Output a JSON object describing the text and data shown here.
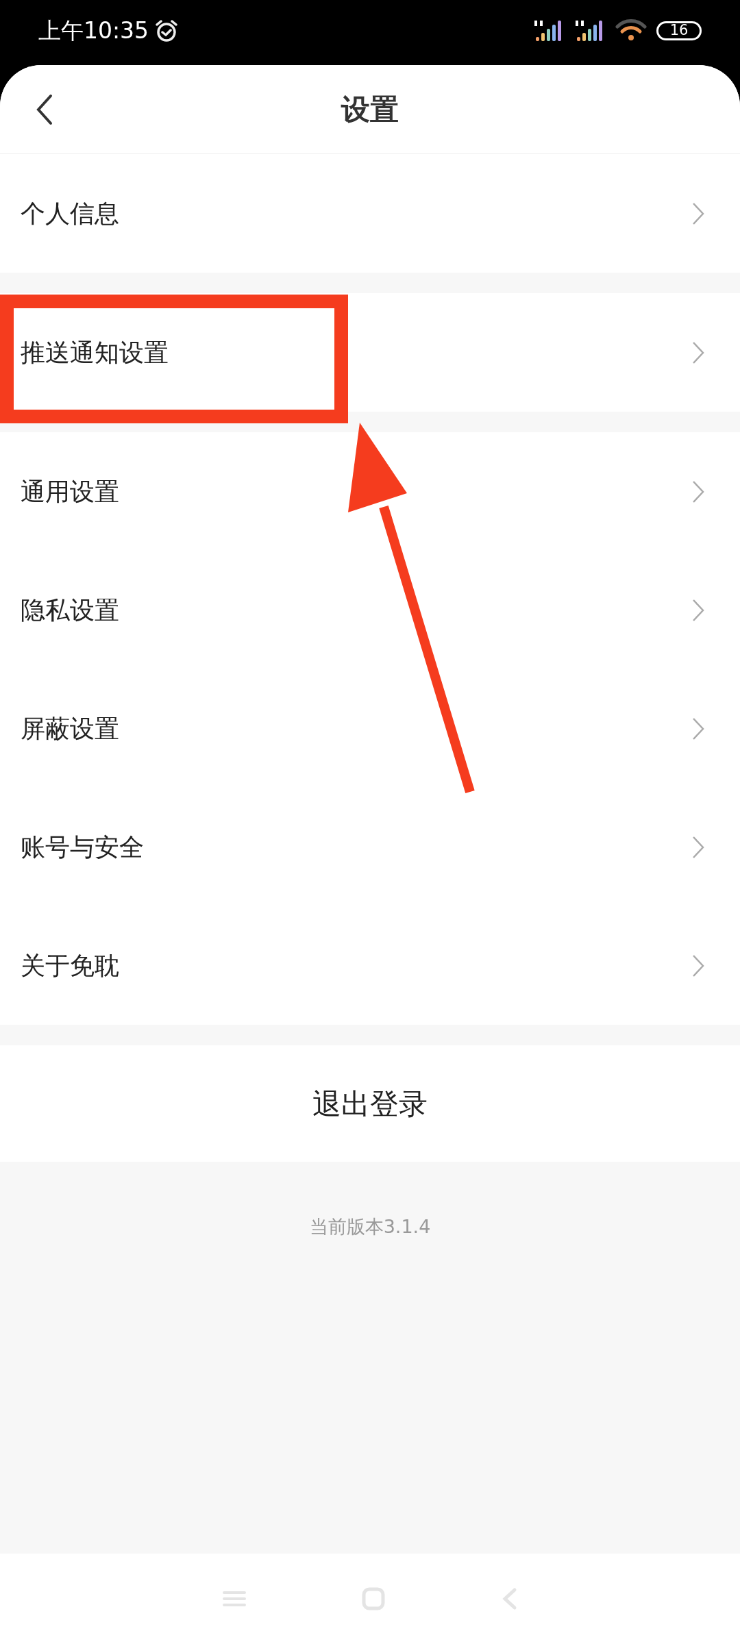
{
  "status_bar": {
    "time": "上午10:35",
    "battery": "16"
  },
  "header": {
    "title": "设置"
  },
  "groups": [
    {
      "items": [
        {
          "label": "个人信息"
        }
      ]
    },
    {
      "items": [
        {
          "label": "推送通知设置"
        }
      ]
    },
    {
      "items": [
        {
          "label": "通用设置"
        },
        {
          "label": "隐私设置"
        },
        {
          "label": "屏蔽设置"
        },
        {
          "label": "账号与安全"
        },
        {
          "label": "关于免耽"
        }
      ]
    }
  ],
  "logout_button": "退出登录",
  "version": "当前版本3.1.4"
}
